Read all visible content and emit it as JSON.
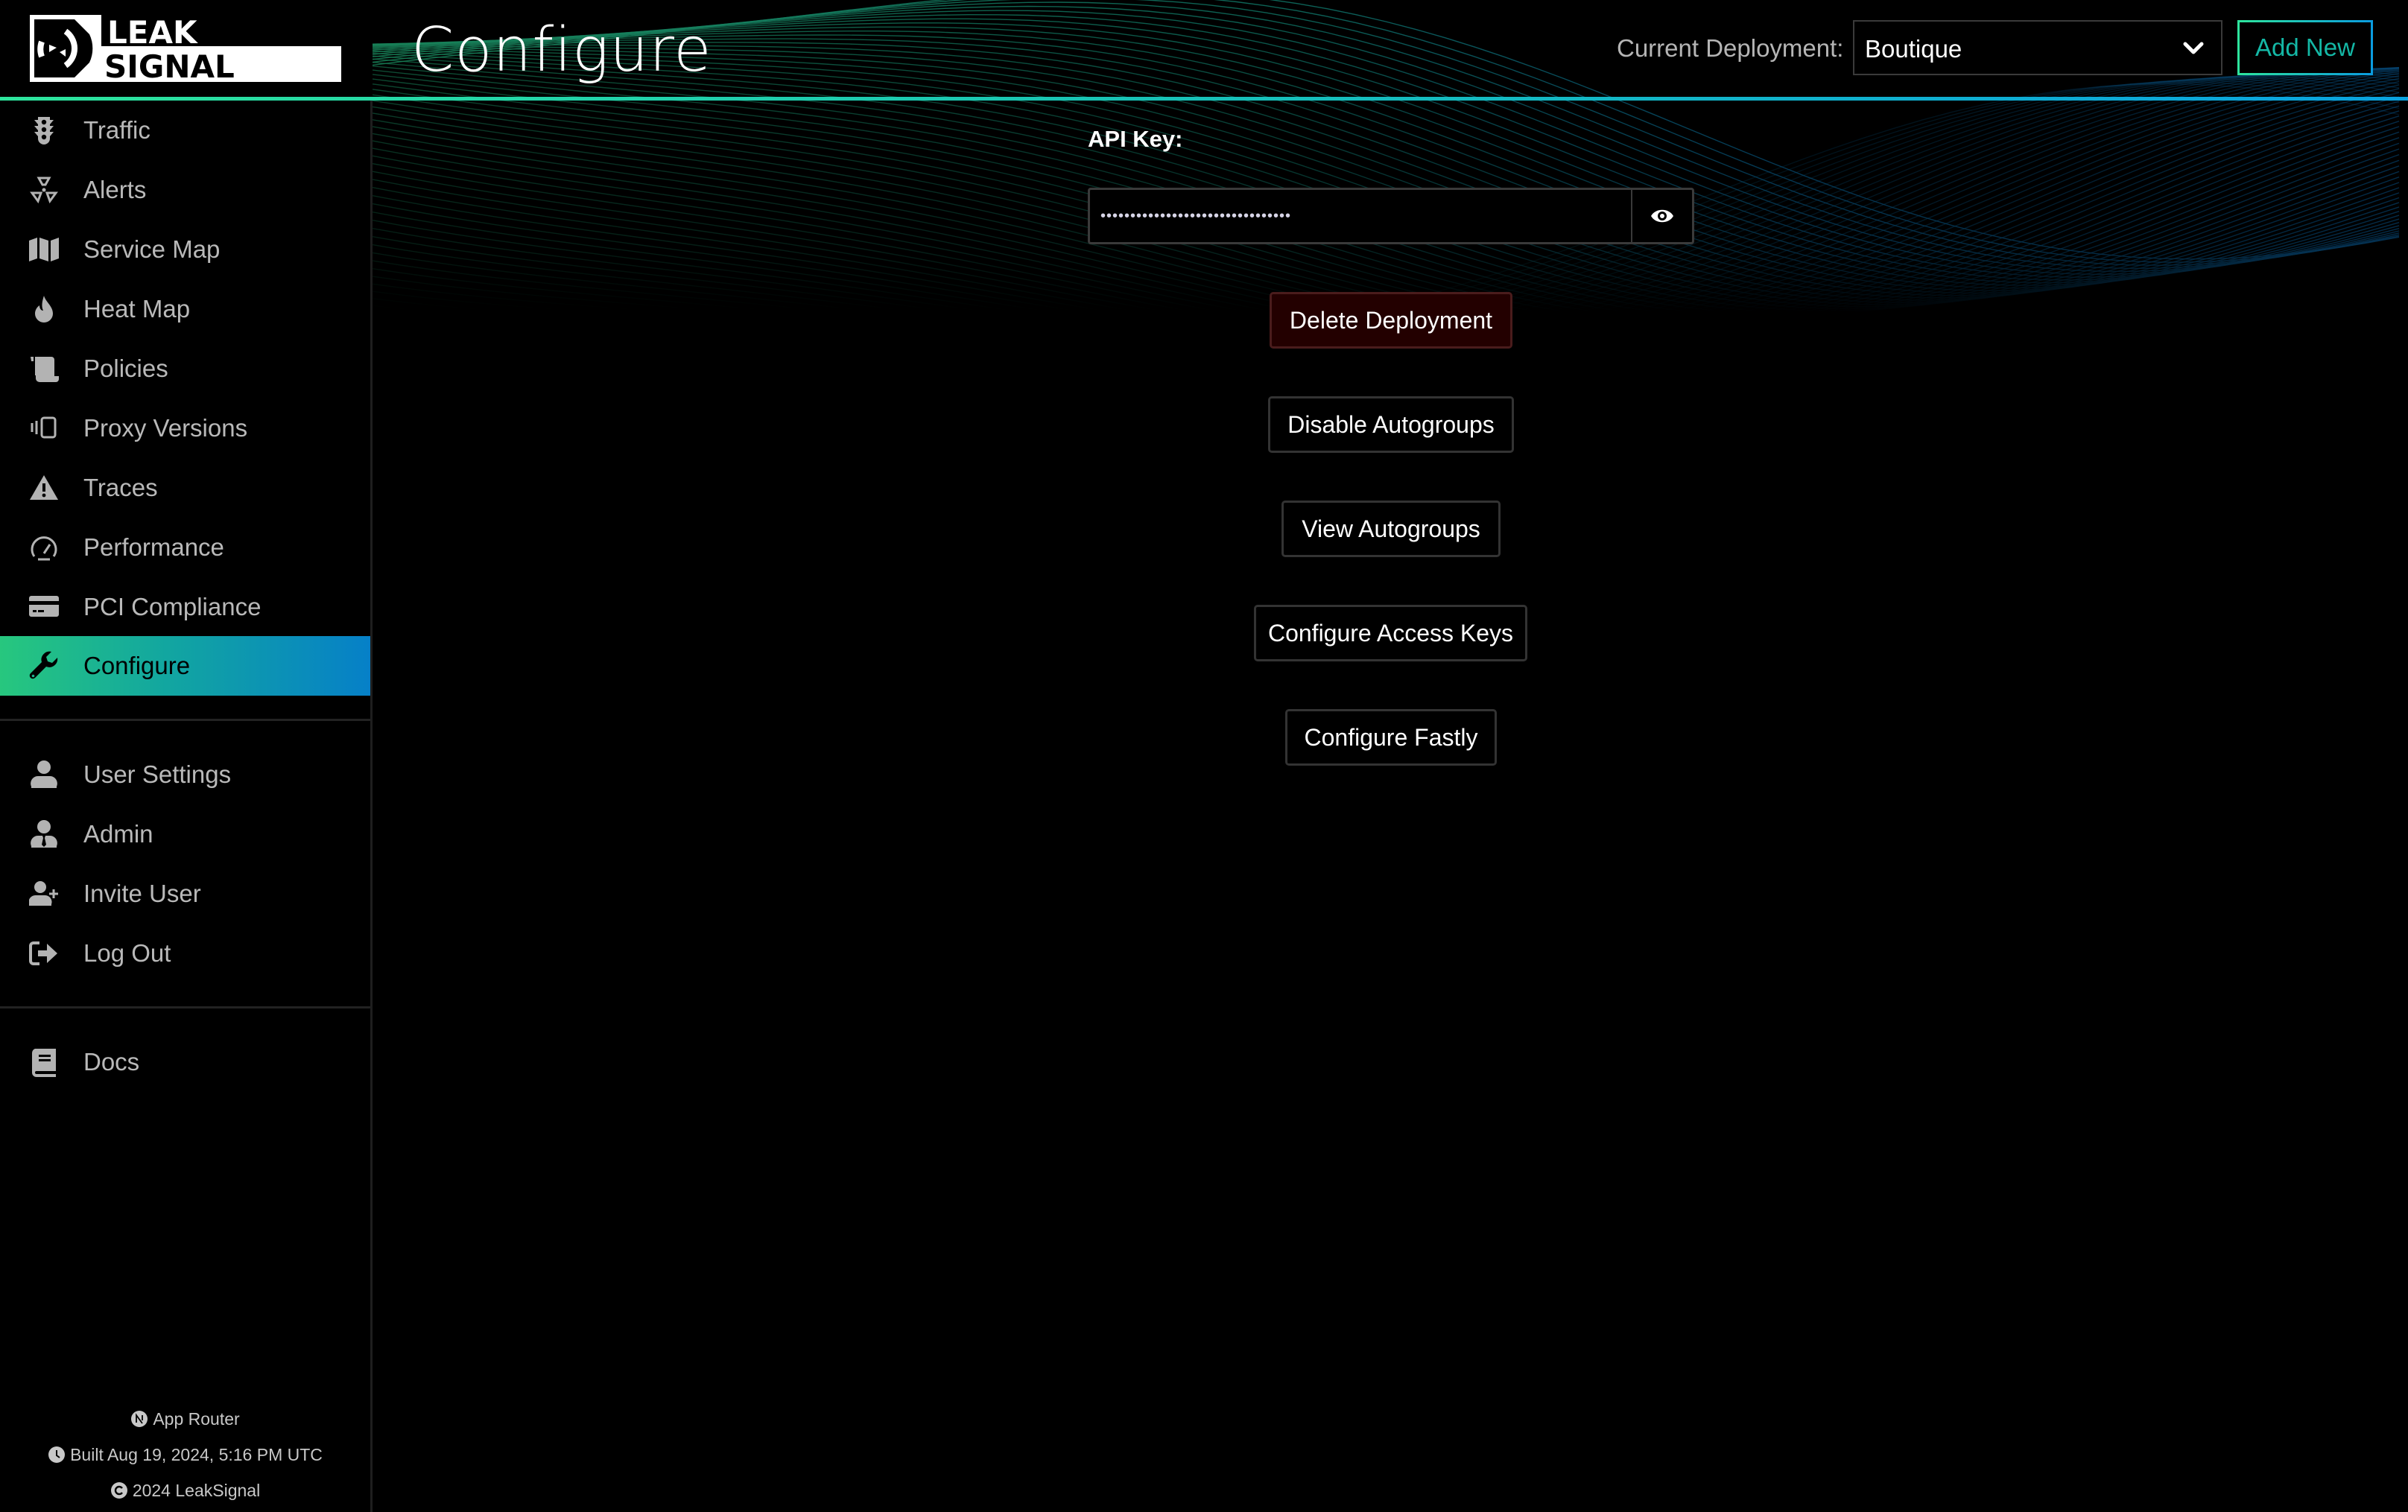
{
  "brand": {
    "logo_line1": "LEAK",
    "logo_line2": "SIGNAL",
    "colors": {
      "accent_green": "#2ee59d",
      "accent_blue": "#0a9be0",
      "add_new_text": "#14b8a6",
      "danger_bg": "#230000"
    }
  },
  "header": {
    "title": "Configure",
    "deployment_label": "Current Deployment:",
    "deployment_selected": "Boutique",
    "add_new_label": "Add New"
  },
  "sidebar": {
    "primary": [
      {
        "label": "Traffic",
        "icon": "traffic-light-icon"
      },
      {
        "label": "Alerts",
        "icon": "radiation-icon"
      },
      {
        "label": "Service Map",
        "icon": "map-icon"
      },
      {
        "label": "Heat Map",
        "icon": "fire-icon"
      },
      {
        "label": "Policies",
        "icon": "scroll-icon"
      },
      {
        "label": "Proxy Versions",
        "icon": "versions-icon"
      },
      {
        "label": "Traces",
        "icon": "warning-triangle-icon"
      },
      {
        "label": "Performance",
        "icon": "gauge-icon"
      },
      {
        "label": "PCI Compliance",
        "icon": "credit-card-icon"
      },
      {
        "label": "Configure",
        "icon": "wrench-icon",
        "active": true
      }
    ],
    "account": [
      {
        "label": "User Settings",
        "icon": "user-icon"
      },
      {
        "label": "Admin",
        "icon": "user-tie-icon"
      },
      {
        "label": "Invite User",
        "icon": "user-plus-icon"
      },
      {
        "label": "Log Out",
        "icon": "sign-out-icon"
      }
    ],
    "resources": [
      {
        "label": "Docs",
        "icon": "book-icon"
      }
    ],
    "footer": {
      "router": "App Router",
      "built": "Built Aug 19, 2024, 5:16 PM UTC",
      "copyright": "2024 LeakSignal"
    }
  },
  "main": {
    "api_key_label": "API Key:",
    "api_key_masked": "••••••••••••••••••••••••••••••••",
    "api_key_visibility_icon": "eye-icon",
    "buttons": {
      "delete_deployment": "Delete Deployment",
      "disable_autogroups": "Disable Autogroups",
      "view_autogroups": "View Autogroups",
      "configure_access_keys": "Configure Access Keys",
      "configure_fastly": "Configure Fastly"
    }
  }
}
